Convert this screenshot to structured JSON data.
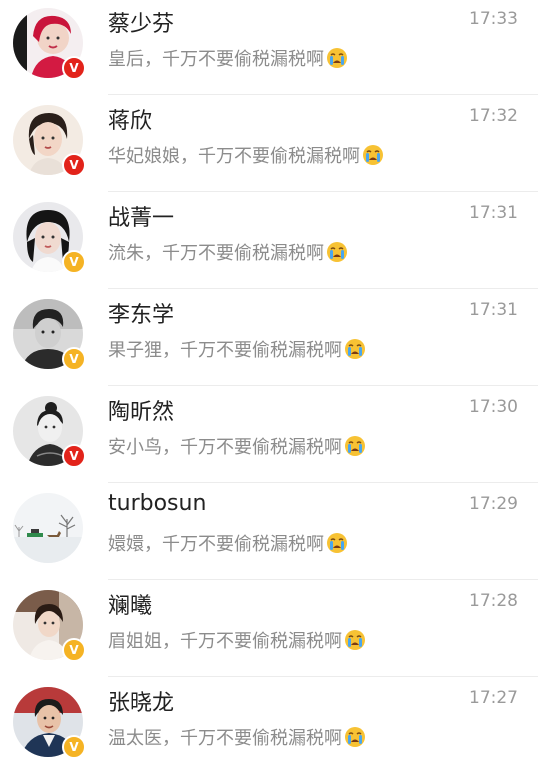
{
  "badge_colors": {
    "red": "#e2231a",
    "gold": "#f5b324"
  },
  "emoji": "loudly-crying-face",
  "chats": [
    {
      "name": "蔡少芬",
      "time": "17:33",
      "message": "皇后，千万不要偷税漏税啊",
      "badge": "red"
    },
    {
      "name": "蒋欣",
      "time": "17:32",
      "message": "华妃娘娘，千万不要偷税漏税啊",
      "badge": "red"
    },
    {
      "name": "战菁一",
      "time": "17:31",
      "message": "流朱，千万不要偷税漏税啊",
      "badge": "gold"
    },
    {
      "name": "李东学",
      "time": "17:31",
      "message": "果子狸，千万不要偷税漏税啊",
      "badge": "gold"
    },
    {
      "name": "陶昕然",
      "time": "17:30",
      "message": "安小鸟，千万不要偷税漏税啊",
      "badge": "red"
    },
    {
      "name": "turbosun",
      "time": "17:29",
      "message": "嬛嬛，千万不要偷税漏税啊",
      "badge": "none"
    },
    {
      "name": "斓曦",
      "time": "17:28",
      "message": "眉姐姐，千万不要偷税漏税啊",
      "badge": "gold"
    },
    {
      "name": "张晓龙",
      "time": "17:27",
      "message": "温太医，千万不要偷税漏税啊",
      "badge": "gold"
    }
  ]
}
